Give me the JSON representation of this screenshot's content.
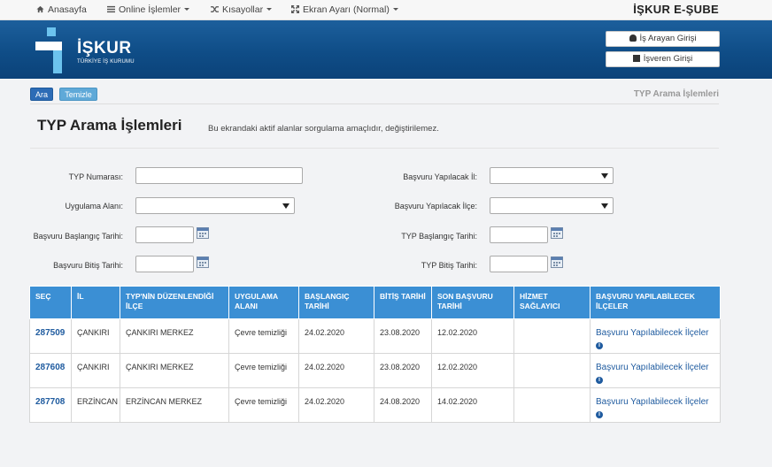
{
  "topnav": {
    "home": "Anasayfa",
    "online": "Online İşlemler",
    "shortcuts": "Kısayollar",
    "screen": "Ekran Ayarı (Normal)",
    "brand": "İŞKUR E-ŞUBE"
  },
  "header": {
    "logo_text": "İŞKUR",
    "logo_sub": "TÜRKİYE İŞ KURUMU",
    "job_seeker_login": "İş Arayan Girişi",
    "employer_login": "İşveren Girişi"
  },
  "toolbar": {
    "search": "Ara",
    "clear": "Temizle",
    "breadcrumb": "TYP Arama İşlemleri"
  },
  "page": {
    "title": "TYP Arama İşlemleri",
    "description": "Bu ekrandaki aktif alanlar sorgulama amaçlıdır, değiştirilemez."
  },
  "form": {
    "typ_no_label": "TYP Numarası:",
    "typ_no_value": "",
    "province_label": "Başvuru Yapılacak İl:",
    "province_value": "",
    "area_label": "Uygulama Alanı:",
    "area_value": "",
    "district_label": "Başvuru Yapılacak İlçe:",
    "district_value": "",
    "app_start_label": "Başvuru Başlangıç Tarihi:",
    "app_start_value": "",
    "typ_start_label": "TYP Başlangıç Tarihi:",
    "typ_start_value": "",
    "app_end_label": "Başvuru Bitiş Tarihi:",
    "app_end_value": "",
    "typ_end_label": "TYP Bitiş Tarihi:",
    "typ_end_value": ""
  },
  "table": {
    "headers": {
      "sec": "SEÇ",
      "il": "İL",
      "ilce": "TYP'NİN DÜZENLENDİĞİ İLÇE",
      "alan": "UYGULAMA ALANI",
      "baslangic": "BAŞLANGIÇ TARİHİ",
      "bitis": "BİTİŞ TARİHİ",
      "son": "SON BAŞVURU TARİHİ",
      "hizmet": "HİZMET SAĞLAYICI",
      "basvuru": "BAŞVURU YAPILABİLECEK İLÇELER"
    },
    "rows": [
      {
        "sec": "287509",
        "il": "ÇANKIRI",
        "ilce": "ÇANKIRI MERKEZ",
        "alan": "Çevre temizliği",
        "baslangic": "24.02.2020",
        "bitis": "23.08.2020",
        "son": "12.02.2020",
        "hizmet": "",
        "basvuru": "Başvuru Yapılabilecek İlçeler"
      },
      {
        "sec": "287608",
        "il": "ÇANKIRI",
        "ilce": "ÇANKIRI MERKEZ",
        "alan": "Çevre temizliği",
        "baslangic": "24.02.2020",
        "bitis": "23.08.2020",
        "son": "12.02.2020",
        "hizmet": "",
        "basvuru": "Başvuru Yapılabilecek İlçeler"
      },
      {
        "sec": "287708",
        "il": "ERZİNCAN",
        "ilce": "ERZİNCAN MERKEZ",
        "alan": "Çevre temizliği",
        "baslangic": "24.02.2020",
        "bitis": "24.08.2020",
        "son": "14.02.2020",
        "hizmet": "",
        "basvuru": "Başvuru Yapılabilecek İlçeler"
      }
    ]
  },
  "colors": {
    "header_blue": "#0f4d87",
    "table_header": "#3b8fd4",
    "link": "#1f5b9f"
  }
}
